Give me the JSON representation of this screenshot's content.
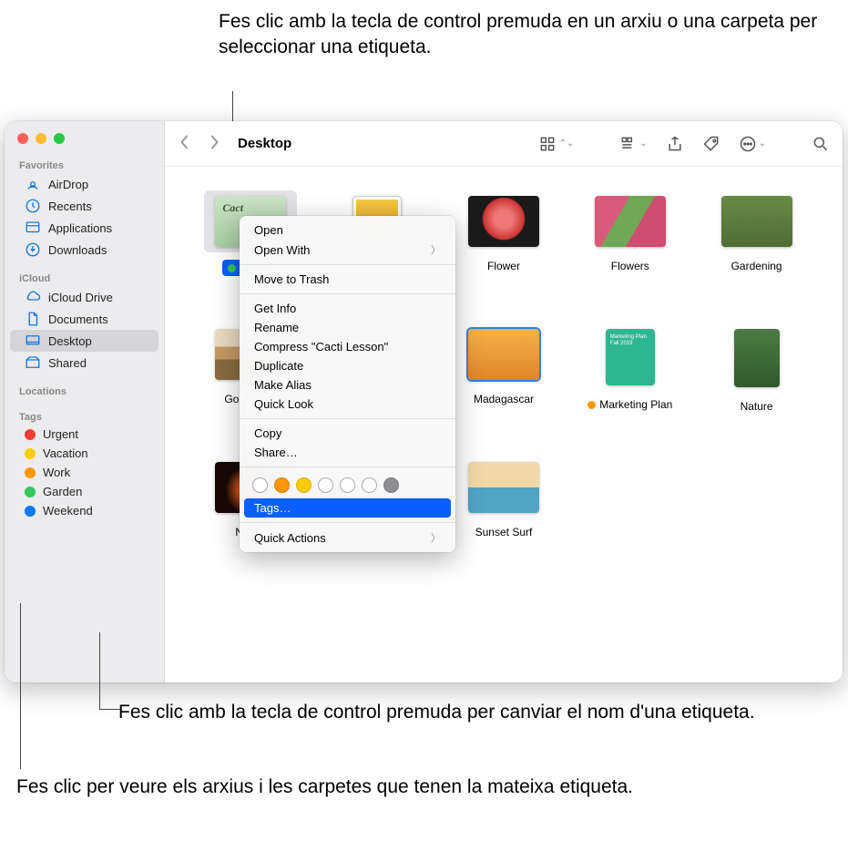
{
  "callouts": {
    "top": "Fes clic amb la tecla de control premuda en un arxiu o una carpeta per seleccionar una etiqueta.",
    "mid": "Fes clic amb la tecla de control premuda per canviar el nom d'una etiqueta.",
    "bottom": "Fes clic per veure els arxius i les carpetes que tenen la mateixa etiqueta."
  },
  "toolbar": {
    "title": "Desktop"
  },
  "sidebar": {
    "sections": {
      "favorites": "Favorites",
      "icloud": "iCloud",
      "locations": "Locations",
      "tags": "Tags"
    },
    "favorites": [
      {
        "label": "AirDrop",
        "icon": "airdrop"
      },
      {
        "label": "Recents",
        "icon": "clock"
      },
      {
        "label": "Applications",
        "icon": "apps"
      },
      {
        "label": "Downloads",
        "icon": "downloads"
      }
    ],
    "icloud": [
      {
        "label": "iCloud Drive",
        "icon": "cloud"
      },
      {
        "label": "Documents",
        "icon": "doc"
      },
      {
        "label": "Desktop",
        "icon": "desktop",
        "selected": true
      },
      {
        "label": "Shared",
        "icon": "shared"
      }
    ],
    "tags_list": [
      {
        "label": "Urgent",
        "color": "#ff3b30"
      },
      {
        "label": "Vacation",
        "color": "#ffcc00"
      },
      {
        "label": "Work",
        "color": "#ff9500"
      },
      {
        "label": "Garden",
        "color": "#34c759"
      },
      {
        "label": "Weekend",
        "color": "#007aff"
      }
    ]
  },
  "files": [
    {
      "label": "Cacti L",
      "class": "cacti",
      "selected": true,
      "tag": "#34c759"
    },
    {
      "label": "",
      "class": "district"
    },
    {
      "label": "Flower",
      "class": "flower"
    },
    {
      "label": "Flowers",
      "class": "flowers"
    },
    {
      "label": "Gardening",
      "class": "garden"
    },
    {
      "label": "Golden Ga",
      "class": "golden"
    },
    {
      "label": "",
      "class": ""
    },
    {
      "label": "Madagascar",
      "class": "madagascar"
    },
    {
      "label": "Marketing Plan",
      "class": "marketing",
      "tag": "#ff9500"
    },
    {
      "label": "Nature",
      "class": "nature"
    },
    {
      "label": "Nightti",
      "class": "night"
    },
    {
      "label": "",
      "class": ""
    },
    {
      "label": "Sunset Surf",
      "class": "sunset"
    }
  ],
  "context_menu": {
    "items": [
      {
        "label": "Open",
        "type": "item"
      },
      {
        "label": "Open With",
        "type": "submenu"
      },
      {
        "type": "sep"
      },
      {
        "label": "Move to Trash",
        "type": "item"
      },
      {
        "type": "sep"
      },
      {
        "label": "Get Info",
        "type": "item"
      },
      {
        "label": "Rename",
        "type": "item"
      },
      {
        "label": "Compress \"Cacti Lesson\"",
        "type": "item"
      },
      {
        "label": "Duplicate",
        "type": "item"
      },
      {
        "label": "Make Alias",
        "type": "item"
      },
      {
        "label": "Quick Look",
        "type": "item"
      },
      {
        "type": "sep"
      },
      {
        "label": "Copy",
        "type": "item"
      },
      {
        "label": "Share…",
        "type": "item"
      },
      {
        "type": "sep"
      },
      {
        "type": "colors"
      },
      {
        "label": "Tags…",
        "type": "highlight"
      },
      {
        "type": "sep"
      },
      {
        "label": "Quick Actions",
        "type": "submenu"
      }
    ],
    "colors": [
      "empty",
      "#ff9500",
      "#ffcc00",
      "empty",
      "empty",
      "empty",
      "#8e8e93"
    ]
  }
}
